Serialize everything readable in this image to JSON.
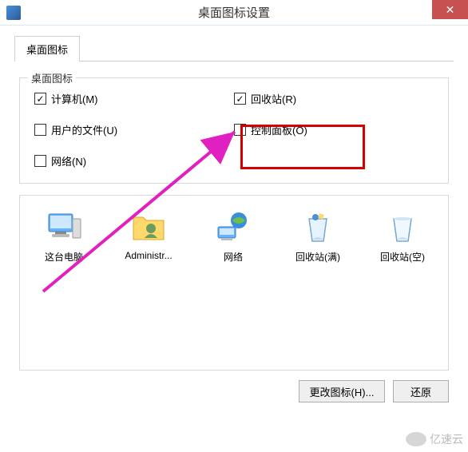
{
  "window": {
    "title": "桌面图标设置",
    "close_glyph": "✕"
  },
  "tabs": {
    "active": {
      "label": "桌面图标"
    }
  },
  "group": {
    "legend": "桌面图标",
    "items": {
      "computer": {
        "label": "计算机(M)",
        "checked": true
      },
      "recycle": {
        "label": "回收站(R)",
        "checked": true
      },
      "userfiles": {
        "label": "用户的文件(U)",
        "checked": false
      },
      "control": {
        "label": "控制面板(O)",
        "checked": false
      },
      "network": {
        "label": "网络(N)",
        "checked": false
      }
    }
  },
  "icons": {
    "pc": {
      "label": "这台电脑"
    },
    "user": {
      "label": "Administr..."
    },
    "network": {
      "label": "网络"
    },
    "recycle_full": {
      "label": "回收站(满)"
    },
    "recycle_empty": {
      "label": "回收站(空)"
    }
  },
  "buttons": {
    "change": "更改图标(H)...",
    "restore": "还原"
  },
  "watermark": "亿速云"
}
